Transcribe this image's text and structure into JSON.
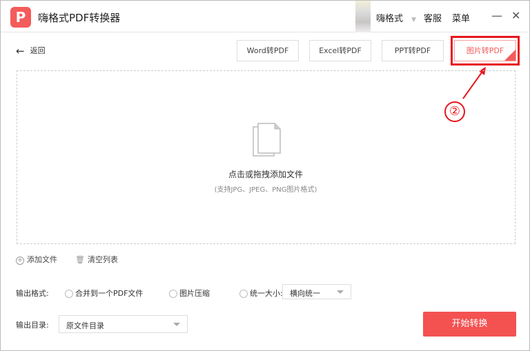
{
  "app": {
    "title": "嗨格式PDF转换器",
    "logo": "P"
  },
  "topnav": {
    "user": "嗨格式",
    "service": "客服",
    "menu": "菜单",
    "minimize": "—",
    "close": "✕"
  },
  "back": {
    "label": "返回"
  },
  "tabs": [
    {
      "label": "Word转PDF"
    },
    {
      "label": "Excel转PDF"
    },
    {
      "label": "PPT转PDF"
    },
    {
      "label": "图片转PDF"
    }
  ],
  "dropzone": {
    "title": "点击或拖拽添加文件",
    "hint": "(支持JPG、JPEG、PNG图片格式)"
  },
  "actions": {
    "add": "添加文件",
    "clear": "清空列表"
  },
  "output_format": {
    "label": "输出格式:",
    "options": [
      "合并到一个PDF文件",
      "图片压缩",
      "统一大小:"
    ],
    "size_select": "横向统一"
  },
  "output_dir": {
    "label": "输出目录:",
    "value": "原文件目录"
  },
  "start": "开始转换",
  "annotation": {
    "step": "②"
  },
  "colors": {
    "accent": "#f45151",
    "highlight": "#e8141c"
  }
}
